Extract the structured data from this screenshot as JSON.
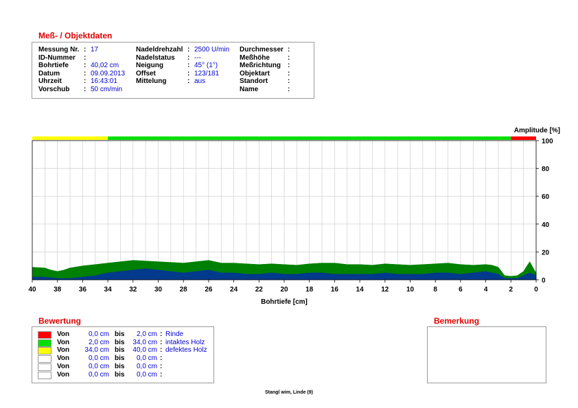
{
  "objekt": {
    "title": "Meß- / Objektdaten",
    "col1": [
      {
        "label": "Messung Nr.",
        "value": "17"
      },
      {
        "label": "ID-Nummer",
        "value": ""
      },
      {
        "label": "Bohrtiefe",
        "value": "40,02 cm"
      },
      {
        "label": "Datum",
        "value": "09.09.2013"
      },
      {
        "label": "Uhrzeit",
        "value": "16:43:01"
      },
      {
        "label": "Vorschub",
        "value": "50 cm/min"
      }
    ],
    "col2": [
      {
        "label": "Nadeldrehzahl",
        "value": "2500 U/min"
      },
      {
        "label": "Nadelstatus",
        "value": "---"
      },
      {
        "label": "Neigung",
        "value": "45° (1°)"
      },
      {
        "label": "Offset",
        "value": "123/181"
      },
      {
        "label": "Mittelung",
        "value": "aus"
      }
    ],
    "col3": [
      {
        "label": "Durchmesser",
        "value": ""
      },
      {
        "label": "Meßhöhe",
        "value": ""
      },
      {
        "label": "Meßrichtung",
        "value": ""
      },
      {
        "label": "Objektart",
        "value": ""
      },
      {
        "label": "Standort",
        "value": ""
      },
      {
        "label": "Name",
        "value": ""
      }
    ]
  },
  "chart_data": {
    "type": "area",
    "xlabel": "Bohrtiefe [cm]",
    "ylabel": "Amplitude [%]",
    "xlim": [
      40,
      0
    ],
    "ylim": [
      0,
      100
    ],
    "x_ticks": [
      "40",
      "38",
      "36",
      "34",
      "32",
      "30",
      "28",
      "26",
      "24",
      "22",
      "20",
      "18",
      "16",
      "14",
      "12",
      "10",
      "8",
      "6",
      "4",
      "2",
      "0"
    ],
    "y_ticks": [
      "0",
      "20",
      "40",
      "60",
      "80",
      "100"
    ],
    "grid": true,
    "zone_bar": [
      {
        "from": 40.0,
        "to": 34.0,
        "color": "#ffff00"
      },
      {
        "from": 34.0,
        "to": 2.0,
        "color": "#00e000"
      },
      {
        "from": 2.0,
        "to": 0.0,
        "color": "#ff0000"
      }
    ],
    "series": [
      {
        "color": "#008000",
        "x": [
          40,
          39,
          38.5,
          38,
          37.5,
          37,
          36,
          35,
          34,
          33,
          32,
          31,
          30,
          29,
          28,
          27,
          26,
          25,
          24,
          23,
          22,
          21,
          20,
          19,
          18,
          17,
          16,
          15,
          14,
          13,
          12,
          11,
          10,
          9,
          8,
          7,
          6,
          5,
          4,
          3.5,
          3,
          2.5,
          2,
          1.5,
          1,
          0.8,
          0.5,
          0.2,
          0
        ],
        "values": [
          9,
          8.5,
          7,
          6,
          7,
          8.5,
          10,
          11,
          12,
          13,
          14,
          13.5,
          13,
          12.5,
          12,
          13,
          14,
          12,
          12,
          11.5,
          11,
          11.5,
          11,
          10.5,
          11.5,
          12,
          12,
          11,
          11,
          10.5,
          11.5,
          11,
          10.5,
          11,
          11.5,
          12,
          11,
          10.5,
          11,
          10.5,
          9,
          3,
          2.5,
          3,
          6,
          9,
          13,
          8,
          5
        ]
      },
      {
        "color": "#003a8c",
        "x": [
          40,
          39,
          38,
          37,
          36,
          35,
          34,
          33,
          32,
          31,
          30,
          29,
          28,
          27,
          26,
          25,
          24,
          23,
          22,
          21,
          20,
          19,
          18,
          17,
          16,
          15,
          14,
          13,
          12,
          11,
          10,
          9,
          8,
          7,
          6,
          5,
          4,
          3.5,
          3,
          2.5,
          2,
          1.5,
          1,
          0.5,
          0
        ],
        "values": [
          2,
          2,
          1,
          1,
          2,
          3,
          5,
          6,
          7,
          8,
          7,
          6,
          5,
          6,
          7,
          5,
          5,
          4,
          4,
          5,
          4,
          4,
          5,
          5,
          4,
          4,
          4,
          4,
          5,
          4,
          4,
          4,
          5,
          5,
          4,
          5,
          6,
          5,
          4,
          1,
          1,
          1,
          3,
          5,
          3
        ]
      }
    ]
  },
  "bewertung": {
    "title": "Bewertung",
    "rows": [
      {
        "color": "#ff0000",
        "von": "Von",
        "from": "0,0 cm",
        "bis": "bis",
        "to": "2,0 cm",
        "colon": ":",
        "label": "Rinde"
      },
      {
        "color": "#00e000",
        "von": "Von",
        "from": "2,0 cm",
        "bis": "bis",
        "to": "34,0 cm",
        "colon": ":",
        "label": "intaktes Holz"
      },
      {
        "color": "#ffff00",
        "von": "Von",
        "from": "34,0 cm",
        "bis": "bis",
        "to": "40,0 cm",
        "colon": ":",
        "label": "defektes Holz"
      },
      {
        "color": "#ffffff",
        "von": "Von",
        "from": "0,0 cm",
        "bis": "bis",
        "to": "0,0 cm",
        "colon": ":",
        "label": ""
      },
      {
        "color": "#ffffff",
        "von": "Von",
        "from": "0,0 cm",
        "bis": "bis",
        "to": "0,0 cm",
        "colon": ":",
        "label": ""
      },
      {
        "color": "#ffffff",
        "von": "Von",
        "from": "0,0 cm",
        "bis": "bis",
        "to": "0,0 cm",
        "colon": ":",
        "label": ""
      }
    ]
  },
  "bemerkung": {
    "title": "Bemerkung",
    "text": ""
  },
  "footer": "Stangl wim, Linde (9)"
}
